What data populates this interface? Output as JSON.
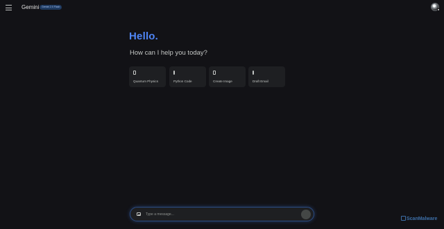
{
  "header": {
    "brand": "Gemini",
    "model_badge": "Gemini 2.0 Flash"
  },
  "greeting": {
    "title": "Hello.",
    "subtitle": "How can I help you today?"
  },
  "suggestions": [
    {
      "label": "Quantum Physics",
      "icon": "document-icon"
    },
    {
      "label": "Python Code",
      "icon": "code-icon"
    },
    {
      "label": "Create Image",
      "icon": "image-icon"
    },
    {
      "label": "Draft Email",
      "icon": "email-icon"
    }
  ],
  "composer": {
    "placeholder": "Type a message..."
  },
  "watermark": "ScanMalware",
  "colors": {
    "background": "#121216",
    "accent": "#4f86f7",
    "card": "#1e1f22"
  }
}
